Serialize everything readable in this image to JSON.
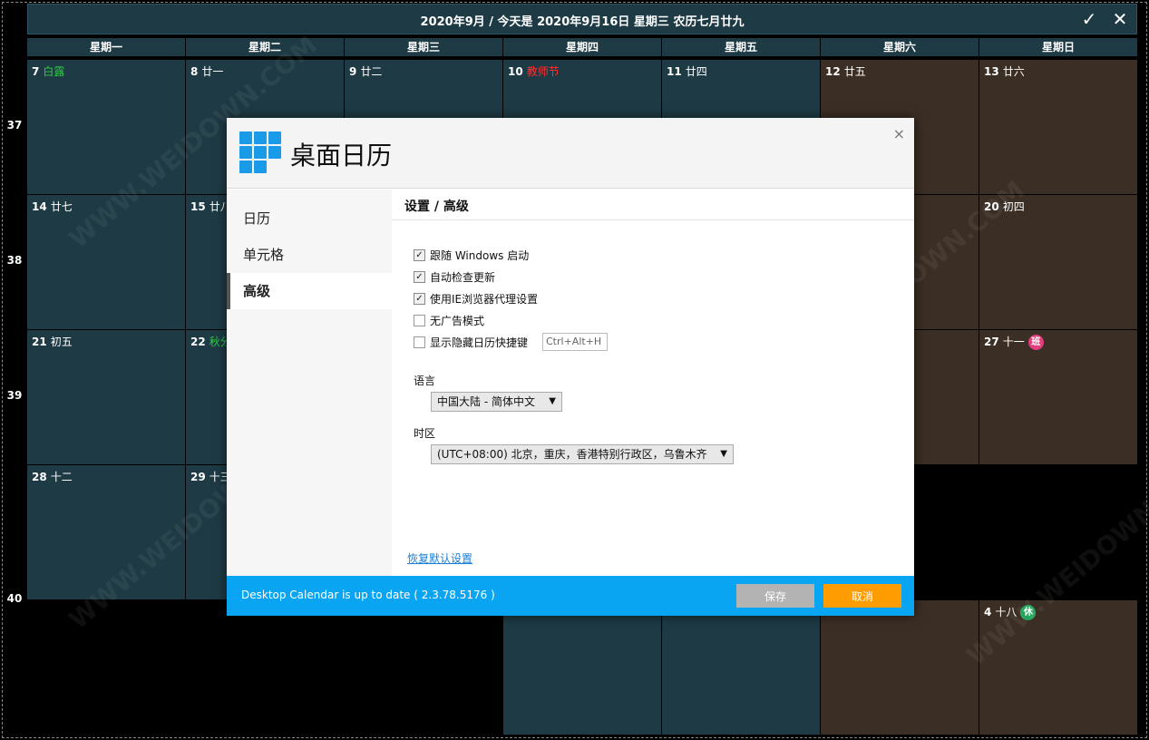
{
  "header": {
    "title": "2020年9月 / 今天是 2020年9月16日 星期三 农历七月廿九",
    "confirm_glyph": "✓",
    "close_glyph": "✕"
  },
  "weekdays": [
    "星期一",
    "星期二",
    "星期三",
    "星期四",
    "星期五",
    "星期六",
    "星期日"
  ],
  "weeks": [
    "37",
    "38",
    "39",
    "40"
  ],
  "days": [
    {
      "num": "7",
      "lunar": "白露",
      "lunar_color": "green"
    },
    {
      "num": "8",
      "lunar": "廿一"
    },
    {
      "num": "9",
      "lunar": "廿二"
    },
    {
      "num": "10",
      "lunar": "教师节",
      "lunar_color": "red"
    },
    {
      "num": "11",
      "lunar": "廿四"
    },
    {
      "num": "12",
      "lunar": "廿五"
    },
    {
      "num": "13",
      "lunar": "廿六"
    },
    {
      "num": "14",
      "lunar": "廿七"
    },
    {
      "num": "15",
      "lunar": "廿八"
    },
    {
      "num": "20",
      "lunar": "初四"
    },
    {
      "num": "21",
      "lunar": "初五"
    },
    {
      "num": "22",
      "lunar": "秋分",
      "lunar_color": "green"
    },
    {
      "num": "27",
      "lunar": "十一",
      "badge": "班"
    },
    {
      "num": "28",
      "lunar": "十二"
    },
    {
      "num": "29",
      "lunar": "十三"
    },
    {
      "num": "4",
      "lunar": "十八",
      "badge": "休"
    }
  ],
  "dialog": {
    "title": "桌面日历",
    "close_glyph": "×",
    "nav": [
      "日历",
      "单元格",
      "高级"
    ],
    "section_title": "设置 / 高级",
    "options": [
      {
        "label": "跟随 Windows 启动",
        "checked": true
      },
      {
        "label": "自动检查更新",
        "checked": true
      },
      {
        "label": "使用IE浏览器代理设置",
        "checked": true
      },
      {
        "label": "无广告模式",
        "checked": false
      },
      {
        "label": "显示隐藏日历快捷键",
        "checked": false
      }
    ],
    "hotkey_value": "Ctrl+Alt+H",
    "language_label": "语言",
    "language_value": "中国大陆 - 简体中文",
    "timezone_label": "时区",
    "timezone_value": "(UTC+08:00) 北京，重庆，香港特别行政区，乌鲁木齐",
    "restore_link": "恢复默认设置",
    "status_text": "Desktop Calendar is up to date ( 2.3.78.5176 )",
    "save_label": "保存",
    "cancel_label": "取消",
    "accent_color": "#0aa5f2",
    "cancel_color": "#ff9c00"
  },
  "watermark": "WWW.WEIDOWN.COM"
}
